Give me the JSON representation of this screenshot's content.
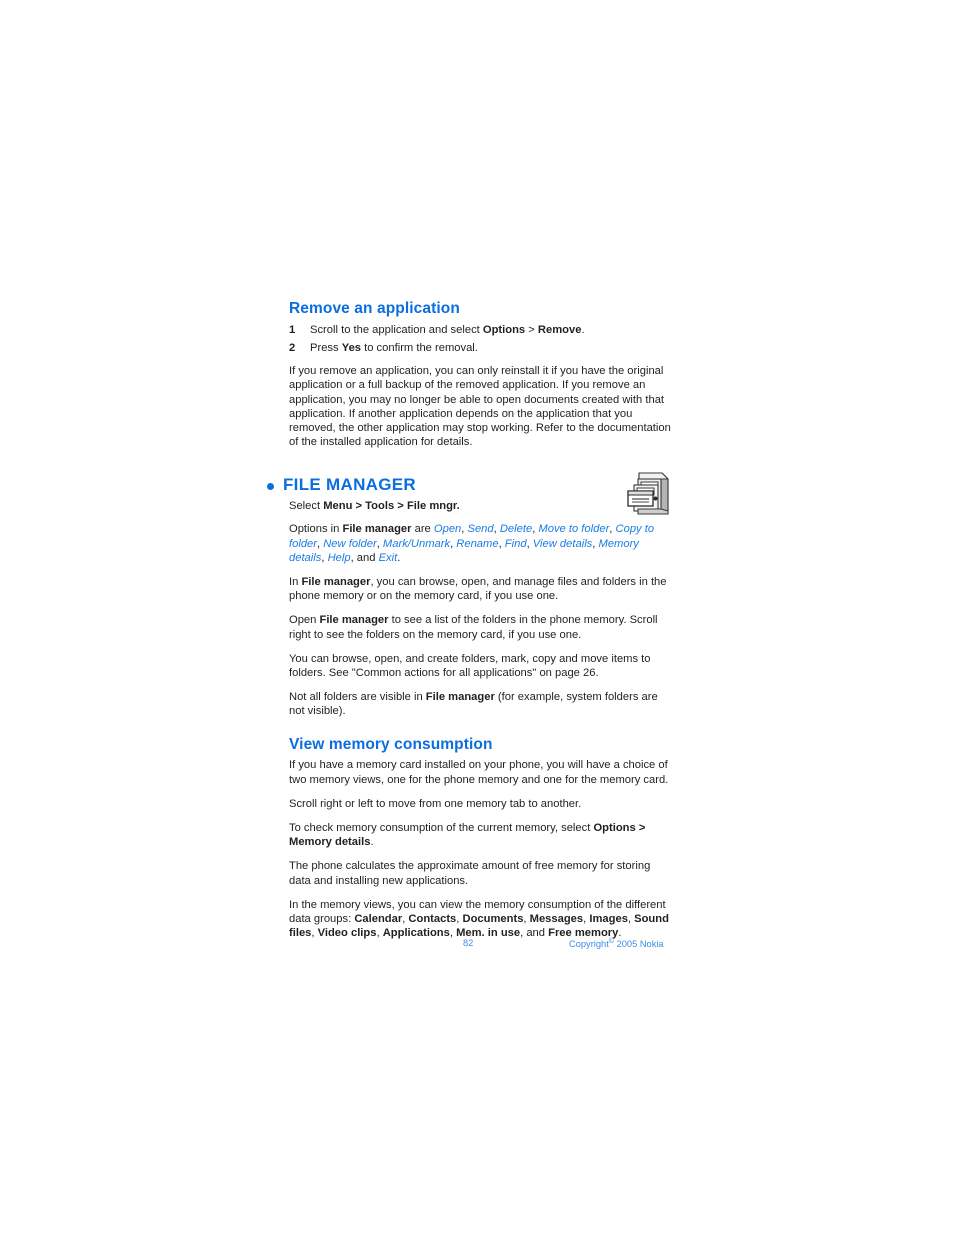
{
  "page": {
    "number": "82",
    "copyright_prefix": "Copyright",
    "copyright_symbol": "©",
    "copyright_suffix": "2005 Nokia"
  },
  "colors": {
    "heading_blue": "#0a6ee1",
    "option_blue": "#1b7ce8",
    "footer_blue": "#3d8ce8",
    "body_black": "#231f20"
  },
  "sections": {
    "remove_application": {
      "heading": "Remove an application",
      "steps": [
        {
          "num": "1",
          "pre": "Scroll to the application and select ",
          "bold1": "Options",
          "mid": " > ",
          "bold2": "Remove",
          "post": "."
        },
        {
          "num": "2",
          "pre": "Press ",
          "bold1": "Yes",
          "mid": " to confirm the removal.",
          "bold2": "",
          "post": ""
        }
      ],
      "paragraph": "If you remove an application, you can only reinstall it if you have the original application or a full backup of the removed application. If you remove an application, you may no longer be able to open documents created with that application. If another application depends on the application that you removed, the other application may stop working. Refer to the documentation of the installed application for details."
    },
    "file_manager": {
      "heading": "FILE MANAGER",
      "icon_name": "file-manager-cabinet-icon",
      "select_path": {
        "pre": "Select ",
        "b1": "Menu",
        "sep1": " > ",
        "b2": "Tools",
        "sep2": " > ",
        "b3": "File mngr.",
        "post": ""
      },
      "options_intro_pre": "Options in ",
      "options_intro_bold": "File manager",
      "options_intro_post": " are ",
      "options": [
        "Open",
        "Send",
        "Delete",
        "Move to folder",
        "Copy to folder",
        "New folder",
        "Mark/Unmark",
        "Rename",
        "Find",
        "View details",
        "Memory details",
        "Help",
        "Exit"
      ],
      "options_conjunction": "and",
      "paragraphs": [
        {
          "pre": "In ",
          "bold": "File manager",
          "post": ", you can browse, open, and manage files and folders in the phone memory or on the memory card, if you use one."
        },
        {
          "pre": "Open ",
          "bold": "File manager",
          "post": " to see a list of the folders in the phone memory. Scroll right to see the folders on the memory card, if you use one."
        },
        {
          "pre": "",
          "bold": "",
          "post": "You can browse, open, and create folders, mark, copy and move items to folders. See \"Common actions for all applications\" on page 26."
        },
        {
          "pre": "Not all folders are visible in ",
          "bold": "File manager",
          "post": " (for example, system folders are not visible)."
        }
      ]
    },
    "view_memory": {
      "heading": "View memory consumption",
      "p1": "If you have a memory card installed on your phone, you will have a choice of two memory views, one for the phone memory and one for the memory card.",
      "p2": "Scroll right or left to move from one memory tab to another.",
      "p3": {
        "pre": "To check memory consumption of the current memory, select ",
        "bold1": "Options",
        "mid": " > ",
        "bold2": "Memory details",
        "post": "."
      },
      "p4": "The phone calculates the approximate amount of free memory for storing data and installing new applications.",
      "p5": {
        "pre": "In the memory views, you can view the memory consumption of the different data groups: ",
        "groups": [
          "Calendar",
          "Contacts",
          "Documents",
          "Messages",
          "Images",
          "Sound files",
          "Video clips",
          "Applications",
          "Mem. in use",
          "Free memory"
        ],
        "conjunction": "and",
        "post": "."
      }
    }
  }
}
